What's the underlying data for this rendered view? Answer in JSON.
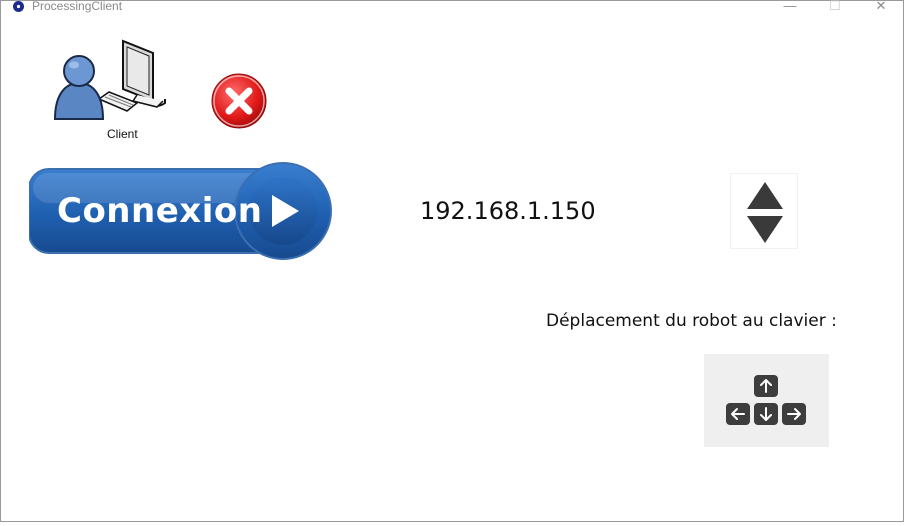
{
  "window": {
    "title": "ProcessingClient",
    "minimize_glyph": "—",
    "maximize_glyph": "☐",
    "close_glyph": "✕"
  },
  "client": {
    "label": "Client",
    "icon": "user-computer-icon"
  },
  "connection_status": {
    "icon": "red-x-icon",
    "color": "#e02020"
  },
  "connect_button": {
    "label": "Connexion",
    "color": "#1f5fb0"
  },
  "server": {
    "ip_address": "192.168.1.150"
  },
  "keyboard_control": {
    "label": "Déplacement du robot au clavier :",
    "keys": [
      "arrow-up-key",
      "arrow-left-key",
      "arrow-down-key",
      "arrow-right-key"
    ]
  }
}
